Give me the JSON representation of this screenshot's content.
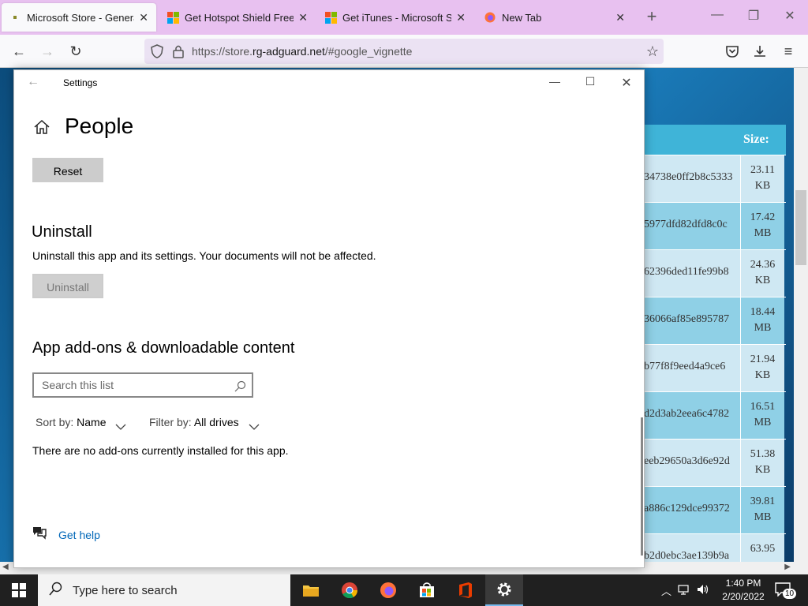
{
  "browser": {
    "tabs": [
      {
        "title": "Microsoft Store - Generation Project",
        "favicon": "rg-adguard-icon"
      },
      {
        "title": "Get Hotspot Shield Free VPN",
        "favicon": "microsoft-logo-icon"
      },
      {
        "title": "Get iTunes - Microsoft Store",
        "favicon": "microsoft-logo-icon"
      },
      {
        "title": "New Tab",
        "favicon": "firefox-icon"
      }
    ],
    "url_prefix": "https://store.",
    "url_domain": "rg-adguard.net",
    "url_suffix": "/#google_vignette"
  },
  "webpage": {
    "size_header": "Size:",
    "rows": [
      {
        "hash": "34738e0ff2b8c5333",
        "size1": "23.11",
        "size2": "KB"
      },
      {
        "hash": "5977dfd82dfd8c0c",
        "size1": "17.42",
        "size2": "MB"
      },
      {
        "hash": "62396ded11fe99b8",
        "size1": "24.36",
        "size2": "KB"
      },
      {
        "hash": "36066af85e895787",
        "size1": "18.44",
        "size2": "MB"
      },
      {
        "hash": "b77f8f9eed4a9ce6",
        "size1": "21.94",
        "size2": "KB"
      },
      {
        "hash": "d2d3ab2eea6c4782",
        "size1": "16.51",
        "size2": "MB"
      },
      {
        "hash": "eeb29650a3d6e92d",
        "size1": "51.38",
        "size2": "KB"
      },
      {
        "hash": "a886c129dce99372",
        "size1": "39.81",
        "size2": "MB"
      },
      {
        "hash": "b2d0ebc3ae139b9a",
        "size1": "63.95",
        "size2": ""
      }
    ]
  },
  "settings": {
    "window_title": "Settings",
    "page_title": "People",
    "reset_label": "Reset",
    "uninstall_heading": "Uninstall",
    "uninstall_desc": "Uninstall this app and its settings. Your documents will not be affected.",
    "uninstall_label": "Uninstall",
    "addons_heading": "App add-ons & downloadable content",
    "search_placeholder": "Search this list",
    "sort_label": "Sort by:",
    "sort_value": "Name",
    "filter_label": "Filter by:",
    "filter_value": "All drives",
    "no_addons": "There are no add-ons currently installed for this app.",
    "help_label": "Get help"
  },
  "taskbar": {
    "search_placeholder": "Type here to search",
    "time": "1:40 PM",
    "date": "2/20/2022",
    "notification_count": "10",
    "apps": [
      "file-explorer-icon",
      "chrome-icon",
      "firefox-icon",
      "microsoft-store-icon",
      "office-icon",
      "settings-gear-icon"
    ]
  },
  "colors": {
    "tabbar": "#e8c1f0",
    "accent_link": "#0067b8",
    "table_header": "#3fb4d8"
  }
}
